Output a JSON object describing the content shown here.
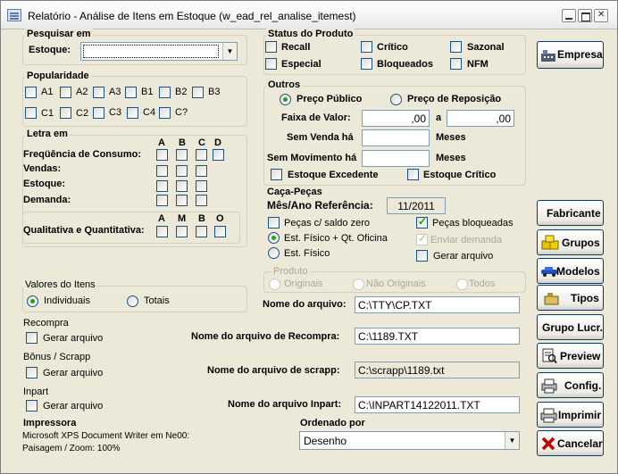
{
  "window": {
    "title": "Relatório - Análise de Itens em Estoque (w_ead_rel_analise_itemest)"
  },
  "pesquisar": {
    "title": "Pesquisar em",
    "estoque_label": "Estoque:",
    "estoque_value": ""
  },
  "popularidade": {
    "title": "Popularidade",
    "row1": [
      "A1",
      "A2",
      "A3",
      "B1",
      "B2",
      "B3"
    ],
    "row2": [
      "C1",
      "C2",
      "C3",
      "C4",
      "C?"
    ]
  },
  "letra": {
    "title": "Letra em",
    "cols": [
      "A",
      "B",
      "C",
      "D"
    ],
    "rows": [
      "Freqüência de Consumo:",
      "Vendas:",
      "Estoque:",
      "Demanda:"
    ],
    "qual_cols": [
      "A",
      "M",
      "B",
      "O"
    ],
    "qual_label": "Qualitativa e Quantitativa:"
  },
  "status": {
    "title": "Status do Produto",
    "items": [
      "Recall",
      "Crítico",
      "Sazonal",
      "Especial",
      "Bloqueados",
      "NFM"
    ]
  },
  "outros": {
    "title": "Outros",
    "preco_publico": "Preço Público",
    "preco_reposicao": "Preço de Reposição",
    "faixa_label": "Faixa de Valor:",
    "faixa_de": ",00",
    "faixa_a_label": "a",
    "faixa_ate": ",00",
    "sem_venda_label": "Sem Venda há",
    "sem_venda_value": "",
    "sem_venda_unit": "Meses",
    "sem_mov_label": "Sem Movimento há",
    "sem_mov_value": "",
    "sem_mov_unit": "Meses",
    "estoque_excedente": "Estoque Excedente",
    "estoque_critico": "Estoque Crítico"
  },
  "caca": {
    "title": "Caça-Peças",
    "mes_ano_label": "Mês/Ano Referência:",
    "mes_ano_value": "11/2011",
    "pecas_saldo_zero": "Peças c/ saldo zero",
    "pecas_bloqueadas": "Peças bloqueadas",
    "est_fisico_qt": "Est. Físico + Qt. Oficina",
    "enviar_demanda": "Enviar demanda",
    "est_fisico": "Est. Físico",
    "gerar_arquivo": "Gerar arquivo"
  },
  "produto": {
    "title": "Produto",
    "originais": "Originais",
    "nao_originais": "Não Originais",
    "todos": "Todos"
  },
  "valores": {
    "title": "Valores do Itens",
    "individuais": "Individuais",
    "totais": "Totais"
  },
  "arquivo": {
    "label": "Nome do arquivo:",
    "value": "C:\\TTY\\CP.TXT"
  },
  "recompra": {
    "title": "Recompra",
    "gerar": "Gerar arquivo",
    "file_label": "Nome do arquivo de Recompra:",
    "file_value": "C:\\1189.TXT"
  },
  "bonus": {
    "title": "Bônus / Scrapp",
    "gerar": "Gerar arquivo",
    "file_label": "Nome do arquivo de scrapp:",
    "file_value": "C:\\scrapp\\1189.txt"
  },
  "inpart": {
    "title": "Inpart",
    "gerar": "Gerar arquivo",
    "file_label": "Nome do arquivo Inpart:",
    "file_value": "C:\\INPART14122011.TXT"
  },
  "impressora": {
    "title": "Impressora",
    "line1": "Microsoft XPS Document Writer em Ne00:",
    "line2": "Paisagem / Zoom: 100%"
  },
  "ordenado": {
    "title": "Ordenado por",
    "value": "Desenho"
  },
  "buttons": {
    "empresa": "Empresa",
    "fabricante": "Fabricante",
    "grupos": "Grupos",
    "modelos": "Modelos",
    "tipos": "Tipos",
    "grupo_lucr": "Grupo Lucr.",
    "preview": "Preview",
    "config": "Config.",
    "imprimir": "Imprimir",
    "cancelar": "Cancelar"
  }
}
